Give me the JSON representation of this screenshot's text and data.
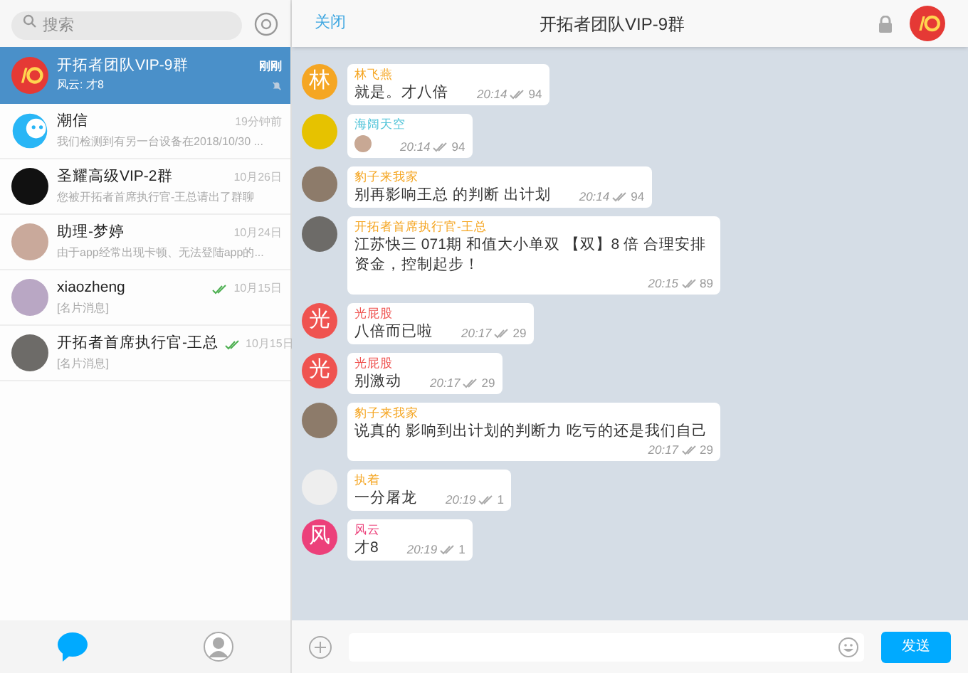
{
  "sidebar": {
    "search": {
      "placeholder": "搜索"
    },
    "chats": [
      {
        "name": "开拓者团队VIP-9群",
        "preview": "风云: 才8",
        "time": "刚刚",
        "selected": true,
        "read": false,
        "muted": true,
        "avatar": {
          "kind": "logo",
          "color": "#e53935"
        }
      },
      {
        "name": "潮信",
        "preview": "我们检测到有另一台设备在2018/10/30 ...",
        "time": "19分钟前",
        "selected": false,
        "read": false,
        "muted": false,
        "avatar": {
          "kind": "face",
          "color": "#29b6f6"
        }
      },
      {
        "name": "圣耀高级VIP-2群",
        "preview": "您被开拓者首席执行官-王总请出了群聊",
        "time": "10月26日",
        "selected": false,
        "read": false,
        "muted": false,
        "avatar": {
          "kind": "photo",
          "color": "#111111"
        }
      },
      {
        "name": "助理-梦婷",
        "preview": "由于app经常出现卡顿、无法登陆app的...",
        "time": "10月24日",
        "selected": false,
        "read": false,
        "muted": false,
        "avatar": {
          "kind": "photo",
          "color": "#c9a99b"
        }
      },
      {
        "name": "xiaozheng",
        "preview": "[名片消息]",
        "time": "10月15日",
        "selected": false,
        "read": true,
        "muted": false,
        "avatar": {
          "kind": "photo",
          "color": "#b9a7c4"
        }
      },
      {
        "name": "开拓者首席执行官-王总",
        "preview": "[名片消息]",
        "time": "10月15日",
        "selected": false,
        "read": true,
        "muted": false,
        "avatar": {
          "kind": "photo",
          "color": "#6d6b68"
        }
      }
    ],
    "tabs": [
      {
        "kind": "chats",
        "selected": true
      },
      {
        "kind": "contacts",
        "selected": false
      }
    ]
  },
  "chat": {
    "close": "关闭",
    "title": "开拓者团队VIP-9群",
    "messages": [
      {
        "sender": "林飞燕",
        "color": "#f5a623",
        "avatar": {
          "kind": "letter",
          "letter": "林",
          "color": "#f5a623"
        },
        "kind": "text",
        "text": "就是。才八倍",
        "time": "20:14",
        "count": "94"
      },
      {
        "sender": "海阔天空",
        "color": "#4fc3d8",
        "avatar": {
          "kind": "photo",
          "color": "#e6c200"
        },
        "kind": "sticker",
        "time": "20:14",
        "count": "94"
      },
      {
        "sender": "豹子来我家",
        "color": "#f5a623",
        "avatar": {
          "kind": "photo",
          "color": "#8d7b6a"
        },
        "kind": "text",
        "text": "别再影响王总 的判断 出计划",
        "time": "20:14",
        "count": "94"
      },
      {
        "sender": "开拓者首席执行官-王总",
        "color": "#f5a623",
        "avatar": {
          "kind": "photo",
          "color": "#6d6b68"
        },
        "kind": "text",
        "text": "江苏快三  071期  和值大小单双  【双】8 倍 合理安排资金，控制起步！",
        "time": "20:15",
        "count": "89"
      },
      {
        "sender": "光屁股",
        "color": "#ef5350",
        "avatar": {
          "kind": "letter",
          "letter": "光",
          "color": "#ef5350"
        },
        "kind": "text",
        "text": "八倍而已啦",
        "time": "20:17",
        "count": "29"
      },
      {
        "sender": "光屁股",
        "color": "#ef5350",
        "avatar": {
          "kind": "letter",
          "letter": "光",
          "color": "#ef5350"
        },
        "kind": "text",
        "text": "别激动",
        "time": "20:17",
        "count": "29"
      },
      {
        "sender": "豹子来我家",
        "color": "#f5a623",
        "avatar": {
          "kind": "photo",
          "color": "#8d7b6a"
        },
        "kind": "text",
        "text": "说真的 影响到出计划的判断力 吃亏的还是我们自己",
        "time": "20:17",
        "count": "29"
      },
      {
        "sender": "执着",
        "color": "#f5a623",
        "avatar": {
          "kind": "photo",
          "color": "#eeeeee"
        },
        "kind": "text",
        "text": "一分屠龙",
        "time": "20:19",
        "count": "1"
      },
      {
        "sender": "风云",
        "color": "#ec407a",
        "avatar": {
          "kind": "letter",
          "letter": "风",
          "color": "#ec407a"
        },
        "kind": "text",
        "text": "才8",
        "time": "20:19",
        "count": "1"
      }
    ],
    "composer": {
      "send": "发送"
    }
  }
}
